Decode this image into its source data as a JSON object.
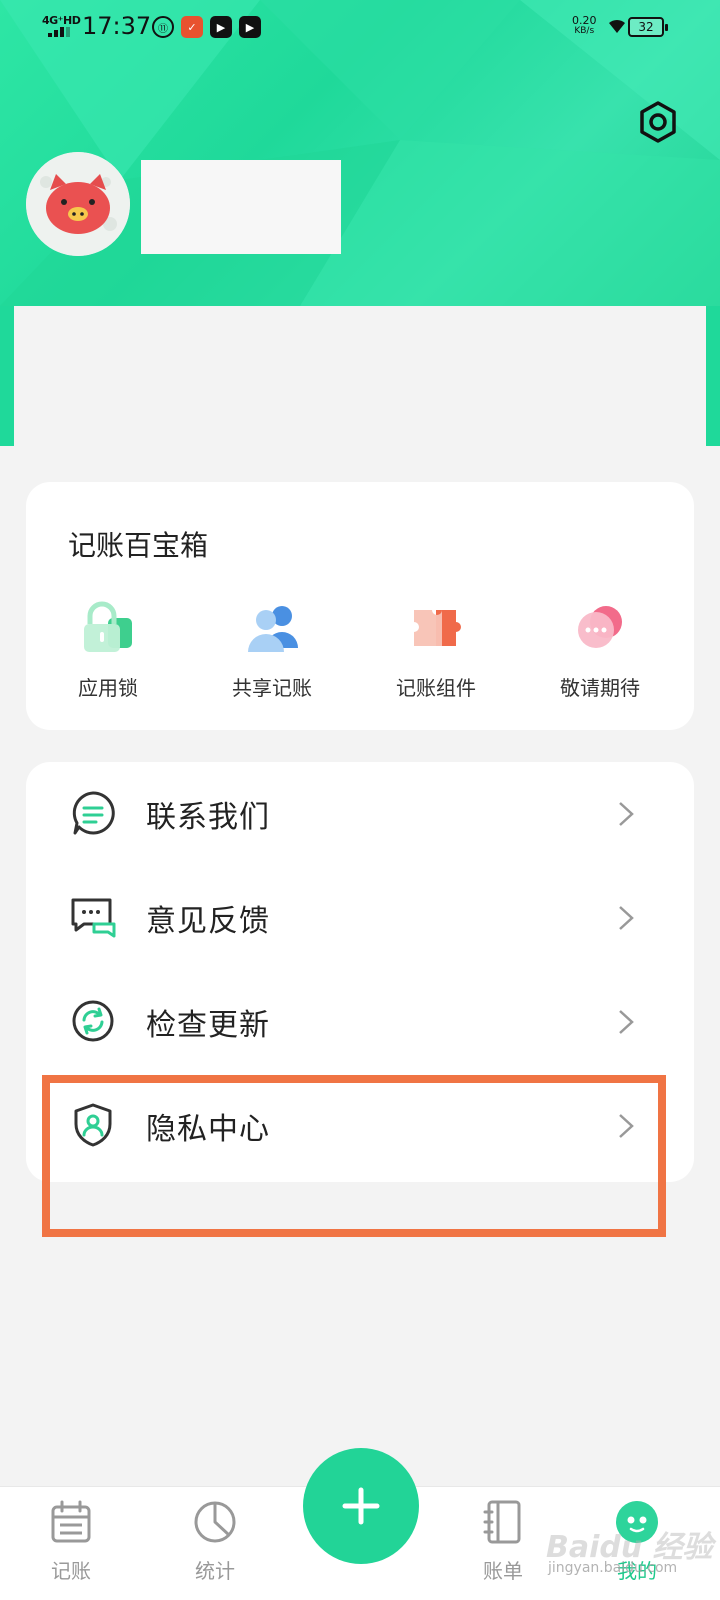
{
  "status_bar": {
    "network": "4G⁺HD",
    "time": "17:37",
    "net_speed_value": "0.20",
    "net_speed_unit": "KB/s",
    "battery": "32"
  },
  "profile": {
    "settings_icon": "gear-icon",
    "avatar_icon": "pig-avatar"
  },
  "toolbox": {
    "title": "记账百宝箱",
    "items": [
      {
        "label": "应用锁",
        "icon": "lock-icon",
        "color": "#3ecf8e"
      },
      {
        "label": "共享记账",
        "icon": "users-icon",
        "color": "#4a90e2"
      },
      {
        "label": "记账组件",
        "icon": "puzzle-icon",
        "color": "#f06a4a"
      },
      {
        "label": "敬请期待",
        "icon": "more-icon",
        "color": "#f26b8a"
      }
    ]
  },
  "menu": {
    "items": [
      {
        "label": "联系我们",
        "icon": "chat-icon"
      },
      {
        "label": "意见反馈",
        "icon": "feedback-icon"
      },
      {
        "label": "检查更新",
        "icon": "refresh-icon"
      },
      {
        "label": "隐私中心",
        "icon": "shield-user-icon"
      }
    ]
  },
  "bottom_nav": {
    "items": [
      {
        "label": "记账",
        "icon": "calendar-icon",
        "active": false
      },
      {
        "label": "统计",
        "icon": "pie-chart-icon",
        "active": false
      },
      {
        "label": "账单",
        "icon": "notebook-icon",
        "active": false
      },
      {
        "label": "我的",
        "icon": "face-icon",
        "active": true
      }
    ],
    "add_icon": "plus-icon"
  },
  "watermark": {
    "brand": "Baidu 经验",
    "url": "jingyan.baidu.com"
  },
  "colors": {
    "accent": "#22d497",
    "highlight": "#f07444"
  }
}
